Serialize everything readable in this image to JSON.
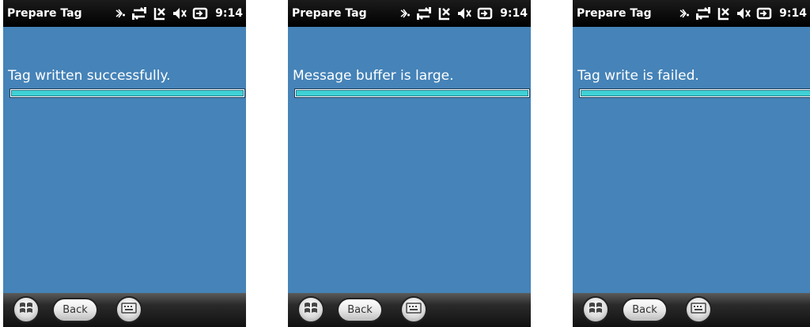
{
  "screens": [
    {
      "title": "Prepare Tag",
      "clock": "9:14",
      "message": "Tag written successfully.",
      "progress": 1.0,
      "back_label": "Back"
    },
    {
      "title": "Prepare Tag",
      "clock": "9:14",
      "message": "Message buffer is large.",
      "progress": 1.0,
      "back_label": "Back"
    },
    {
      "title": "Prepare Tag",
      "clock": "9:14",
      "message": "Tag write is failed.",
      "progress": 1.0,
      "back_label": "Back"
    }
  ],
  "status_icons": [
    "bluetooth-icon",
    "sync-icon",
    "signal-off-icon",
    "speaker-muted-icon",
    "battery-charging-icon"
  ],
  "colors": {
    "background": "#4583b8",
    "titlebar": "#000000",
    "progress_fill": "#3fd2d6"
  }
}
